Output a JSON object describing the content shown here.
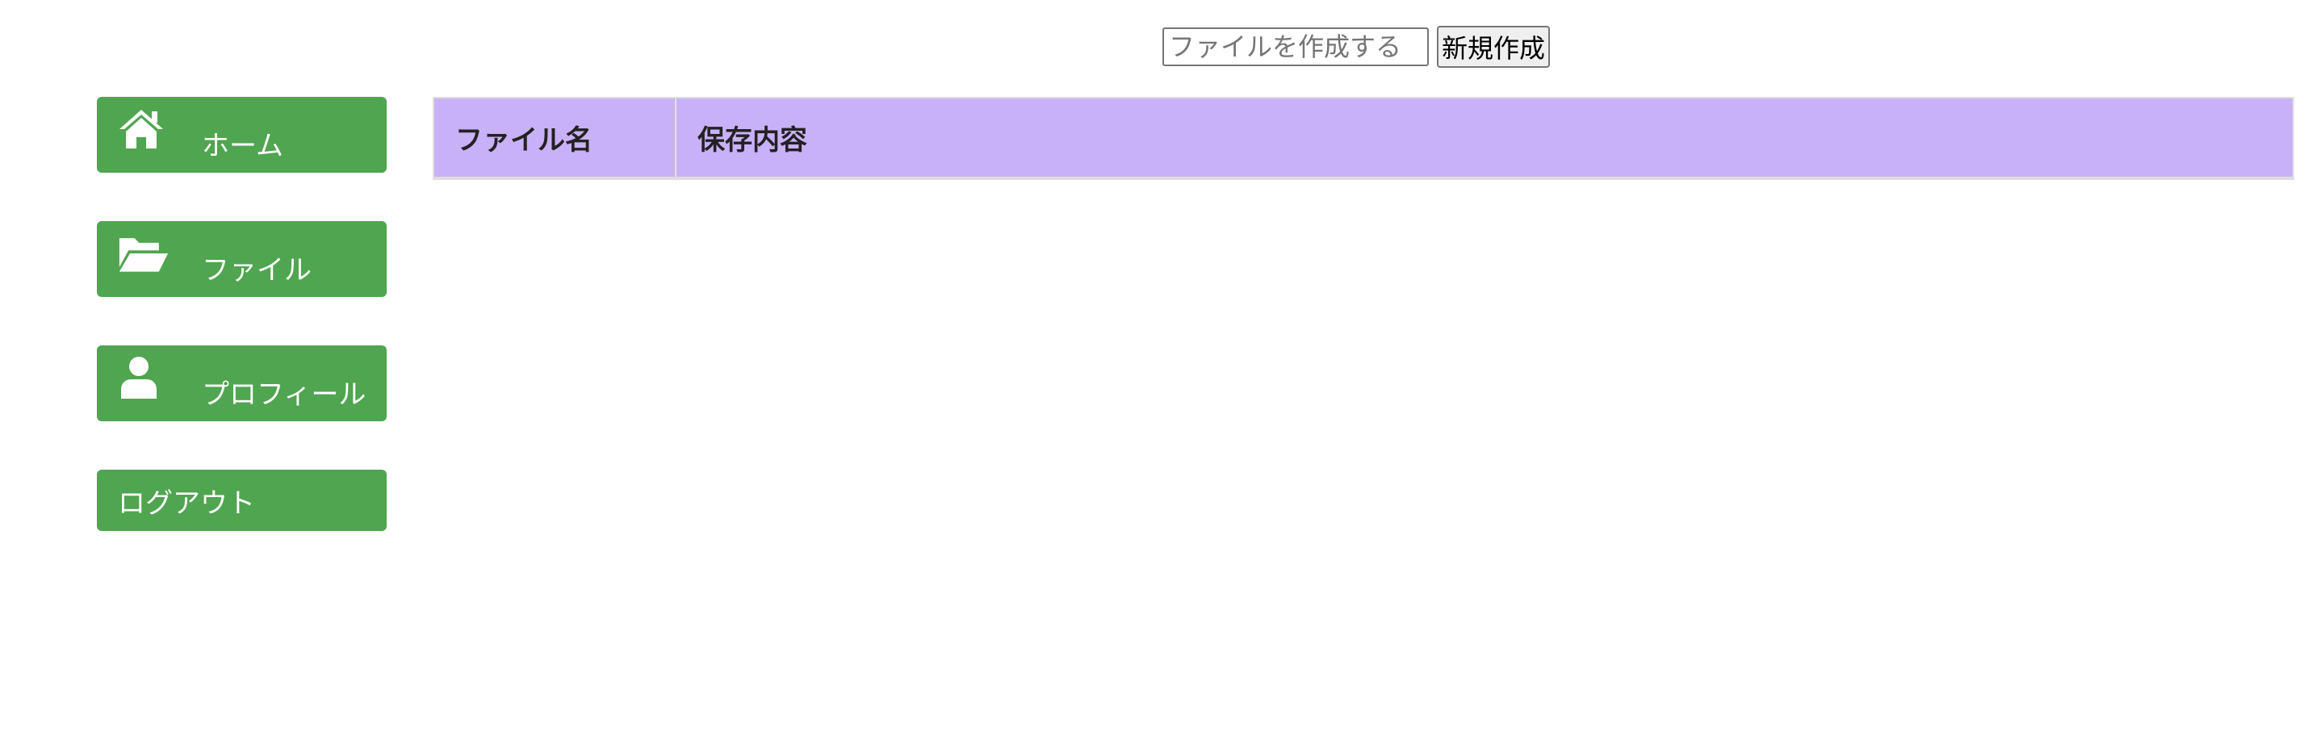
{
  "create": {
    "input_placeholder": "ファイルを作成する",
    "input_value": "",
    "button_label": "新規作成"
  },
  "sidebar": {
    "items": [
      {
        "label": "ホーム",
        "icon": "home-icon"
      },
      {
        "label": "ファイル",
        "icon": "folder-open-icon"
      },
      {
        "label": "プロフィール",
        "icon": "user-icon"
      },
      {
        "label": "ログアウト"
      }
    ]
  },
  "table": {
    "columns": [
      "ファイル名",
      "保存内容"
    ],
    "rows": []
  },
  "colors": {
    "nav_bg": "#50a550",
    "table_header_bg": "#c9b1f8"
  }
}
